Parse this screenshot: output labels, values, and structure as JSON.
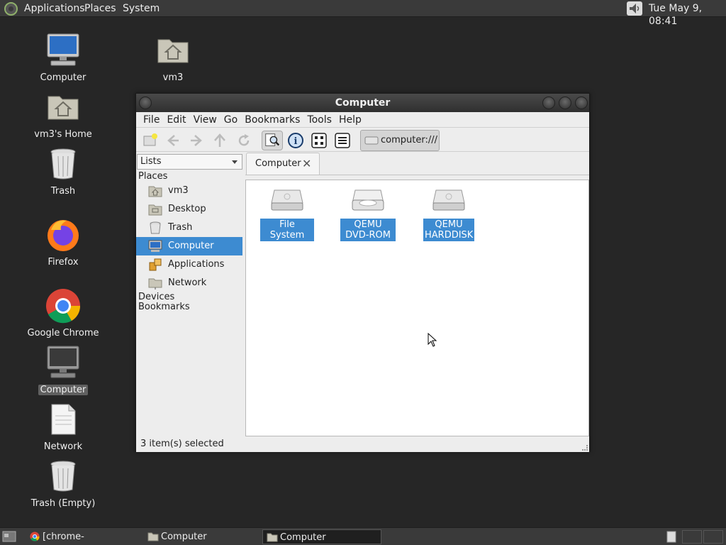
{
  "top_panel": {
    "menus": [
      "Applications",
      "Places",
      "System"
    ],
    "clock": "Tue May  9, 08:41"
  },
  "desktop": {
    "icons": [
      {
        "label": "Computer"
      },
      {
        "label": "vm3"
      },
      {
        "label": "vm3's Home"
      },
      {
        "label": "Trash"
      },
      {
        "label": "Firefox"
      },
      {
        "label": "Google Chrome"
      },
      {
        "label": "Computer"
      },
      {
        "label": "Network"
      },
      {
        "label": "Trash (Empty)"
      }
    ]
  },
  "window": {
    "title": "Computer",
    "menu": [
      "File",
      "Edit",
      "View",
      "Go",
      "Bookmarks",
      "Tools",
      "Help"
    ],
    "location": "computer:///",
    "sidebar": {
      "mode": "Lists",
      "places_header": "Places",
      "places": [
        {
          "label": "vm3",
          "icon": "home-folder-icon"
        },
        {
          "label": "Desktop",
          "icon": "desktop-folder-icon"
        },
        {
          "label": "Trash",
          "icon": "trash-icon"
        },
        {
          "label": "Computer",
          "icon": "computer-icon"
        },
        {
          "label": "Applications",
          "icon": "applications-icon"
        },
        {
          "label": "Network",
          "icon": "network-icon"
        }
      ],
      "devices_header": "Devices",
      "bookmarks_header": "Bookmarks"
    },
    "tab": {
      "label": "Computer",
      "close": "✕"
    },
    "files": [
      {
        "label": "File System"
      },
      {
        "label": "QEMU DVD-ROM"
      },
      {
        "label": "QEMU HARDDISK"
      }
    ],
    "status": "3 item(s) selected"
  },
  "bottom_panel": {
    "tasks": [
      {
        "label": "[chrome-extension://..."
      },
      {
        "label": "Computer"
      },
      {
        "label": "Computer"
      }
    ]
  }
}
